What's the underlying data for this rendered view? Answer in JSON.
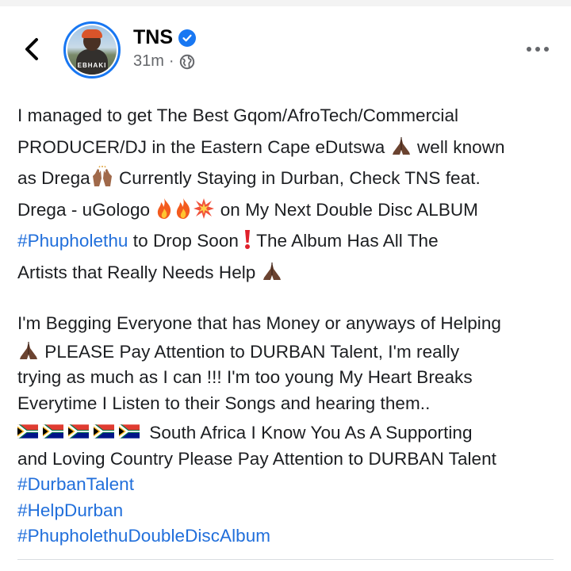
{
  "post": {
    "author_name": "TNS",
    "timestamp": "31m",
    "meta_separator": "·",
    "avatar_caption": "EBHAKI",
    "text": {
      "p1_l1": "I managed to get  The Best Gqom/AfroTech/Commercial",
      "p1_l2a": "PRODUCER/DJ in the Eastern Cape eDutswa",
      "p1_l2b": " well known",
      "p1_l3a": "as Drega",
      "p1_l3b": " Currently Staying in Durban, Check TNS feat.",
      "p1_l4a": "Drega - uGologo ",
      "p1_l4b": " on My  Next Double Disc ALBUM",
      "p1_l5_tag": "#Phupholethu",
      "p1_l5b": " to Drop Soon ",
      "p1_l5c": "  The Album Has All The",
      "p1_l6": "Artists that Really Needs Help ",
      "p2_l1": "I'm Begging Everyone that has Money or anyways of Helping",
      "p2_l2": " PLEASE Pay Attention to DURBAN Talent, I'm really",
      "p2_l3": "trying as much as I can !!! I'm too young My Heart Breaks",
      "p2_l4": "Everytime I Listen to their Songs and hearing them..",
      "p2_l5": " South Africa I Know You As A Supporting",
      "p2_l6": "and Loving Country Please Pay Attention to DURBAN Talent"
    },
    "hashtags": [
      "#DurbanTalent",
      "#HelpDurban",
      "#PhupholethuDoubleDiscAlbum"
    ]
  },
  "icons": {
    "back": "chevron-left-icon",
    "verified": "verified-badge-icon",
    "audience": "globe-icon",
    "more": "more-options-icon",
    "pray": "folded-hands-emoji",
    "raise": "raising-hands-emoji",
    "fire": "fire-emoji",
    "collision": "collision-emoji",
    "exclamation": "red-exclamation-emoji",
    "flag": "south-africa-flag-emoji"
  },
  "colors": {
    "accent": "#1877f2",
    "hashtag": "#216fdb",
    "text": "#1c1e21",
    "meta": "#65676b"
  }
}
